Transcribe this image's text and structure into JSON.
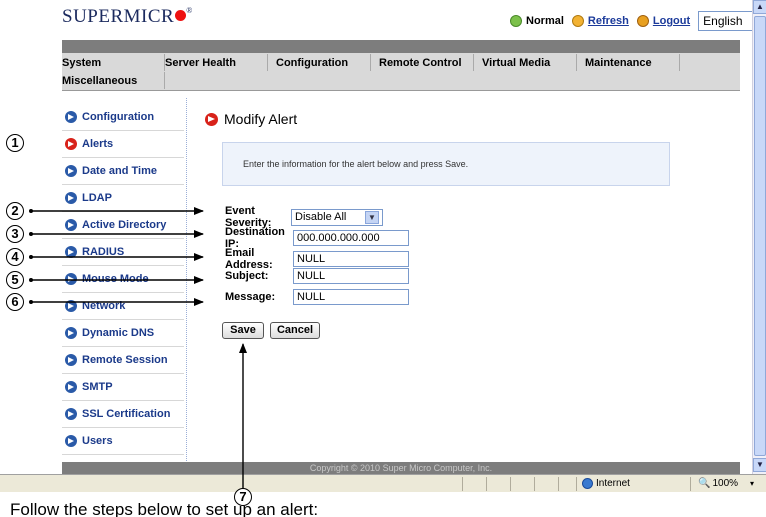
{
  "brand": {
    "name": "SUPERMICR",
    "reg": "®"
  },
  "header": {
    "status_label": "Normal",
    "refresh_label": "Refresh",
    "logout_label": "Logout",
    "language": "English"
  },
  "nav": {
    "row1": [
      "System",
      "Server Health",
      "Configuration",
      "Remote Control",
      "Virtual Media",
      "Maintenance"
    ],
    "row2": [
      "Miscellaneous"
    ]
  },
  "sidebar": {
    "items": [
      {
        "label": "Configuration",
        "active": false
      },
      {
        "label": "Alerts",
        "active": true
      },
      {
        "label": "Date and Time",
        "active": false
      },
      {
        "label": "LDAP",
        "active": false
      },
      {
        "label": "Active Directory",
        "active": false
      },
      {
        "label": "RADIUS",
        "active": false
      },
      {
        "label": "Mouse Mode",
        "active": false
      },
      {
        "label": "Network",
        "active": false
      },
      {
        "label": "Dynamic DNS",
        "active": false
      },
      {
        "label": "Remote Session",
        "active": false
      },
      {
        "label": "SMTP",
        "active": false
      },
      {
        "label": "SSL Certification",
        "active": false
      },
      {
        "label": "Users",
        "active": false
      }
    ]
  },
  "main": {
    "title": "Modify Alert",
    "info": "Enter the information for the alert below and press Save.",
    "form": {
      "severity_label": "Event Severity:",
      "severity_value": "Disable All",
      "ip_label": "Destination IP:",
      "ip_value": "000.000.000.000",
      "email_label": "Email Address:",
      "email_value": "NULL",
      "subject_label": "Subject:",
      "subject_value": "NULL",
      "message_label": "Message:",
      "message_value": "NULL"
    },
    "save_label": "Save",
    "cancel_label": "Cancel"
  },
  "footer": {
    "copyright": "Copyright © 2010 Super Micro Computer, Inc."
  },
  "statusbar": {
    "zone": "Internet",
    "zoom": "100%"
  },
  "callouts": [
    "1",
    "2",
    "3",
    "4",
    "5",
    "6",
    "7"
  ],
  "caption": "Follow the steps below to set up an alert:"
}
